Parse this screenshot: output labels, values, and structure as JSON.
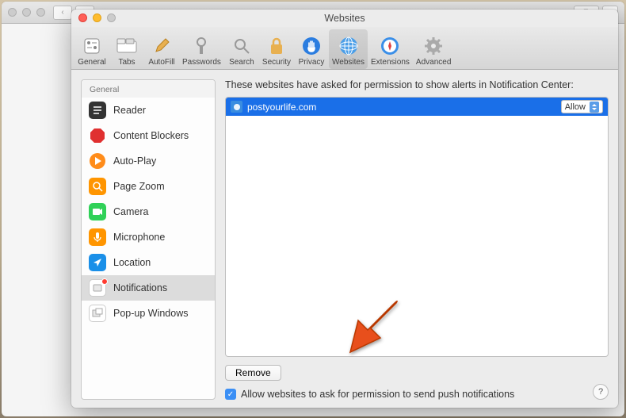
{
  "window": {
    "title": "Websites"
  },
  "toolbar": {
    "items": [
      {
        "label": "General"
      },
      {
        "label": "Tabs"
      },
      {
        "label": "AutoFill"
      },
      {
        "label": "Passwords"
      },
      {
        "label": "Search"
      },
      {
        "label": "Security"
      },
      {
        "label": "Privacy"
      },
      {
        "label": "Websites"
      },
      {
        "label": "Extensions"
      },
      {
        "label": "Advanced"
      }
    ]
  },
  "sidebar": {
    "header": "General",
    "items": [
      {
        "label": "Reader"
      },
      {
        "label": "Content Blockers"
      },
      {
        "label": "Auto-Play"
      },
      {
        "label": "Page Zoom"
      },
      {
        "label": "Camera"
      },
      {
        "label": "Microphone"
      },
      {
        "label": "Location"
      },
      {
        "label": "Notifications"
      },
      {
        "label": "Pop-up Windows"
      }
    ]
  },
  "main": {
    "description": "These websites have asked for permission to show alerts in Notification Center:",
    "sites": [
      {
        "name": "postyourlife.com",
        "permission": "Allow"
      }
    ],
    "remove_label": "Remove",
    "checkbox_label": "Allow websites to ask for permission to send push notifications",
    "checkbox_checked": true,
    "help_label": "?"
  }
}
